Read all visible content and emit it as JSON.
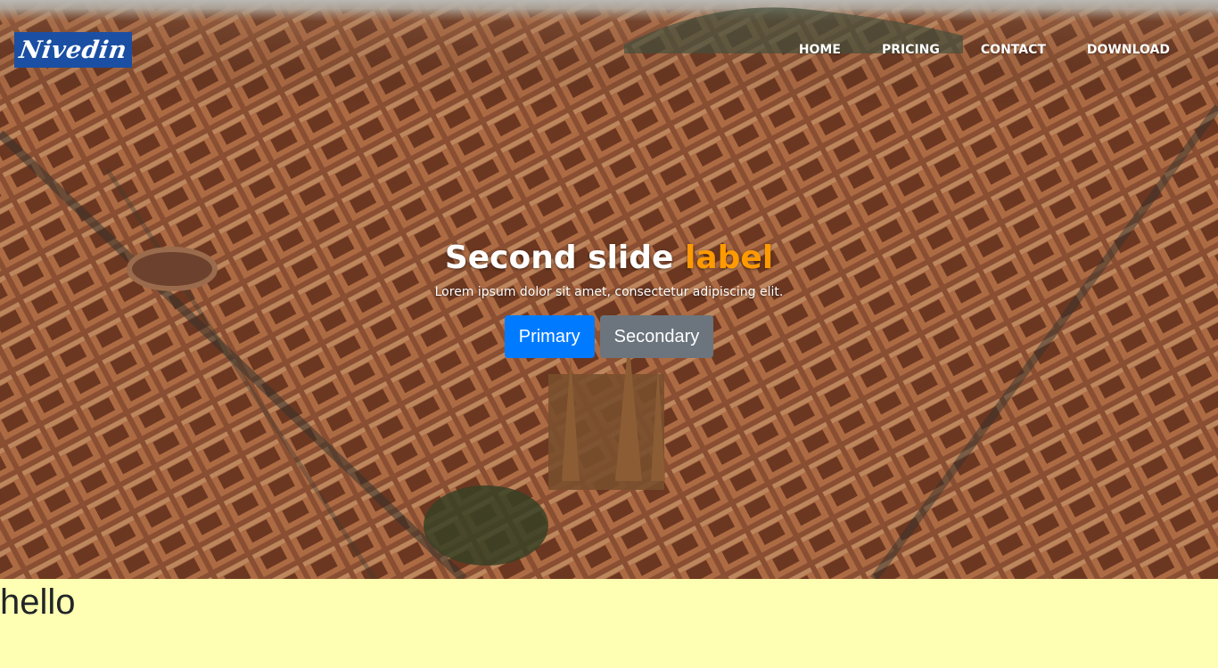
{
  "brand": {
    "logo_text": "Nivedin",
    "color": "#1b4fa3"
  },
  "nav": {
    "items": [
      {
        "label": "HOME"
      },
      {
        "label": "PRICING"
      },
      {
        "label": "CONTACT"
      },
      {
        "label": "DOWNLOAD"
      }
    ]
  },
  "hero": {
    "background": "aerial city photo",
    "title_main": "Second slide",
    "title_accent": "label",
    "accent_color": "#ff9a00",
    "subtitle": "Lorem ipsum dolor sit amet, consectetur adipiscing elit.",
    "buttons": {
      "primary": {
        "label": "Primary",
        "color": "#007bff"
      },
      "secondary": {
        "label": "Secondary",
        "color": "#6c757d"
      }
    }
  },
  "section": {
    "heading": "hello",
    "background": "#ffffb3"
  }
}
